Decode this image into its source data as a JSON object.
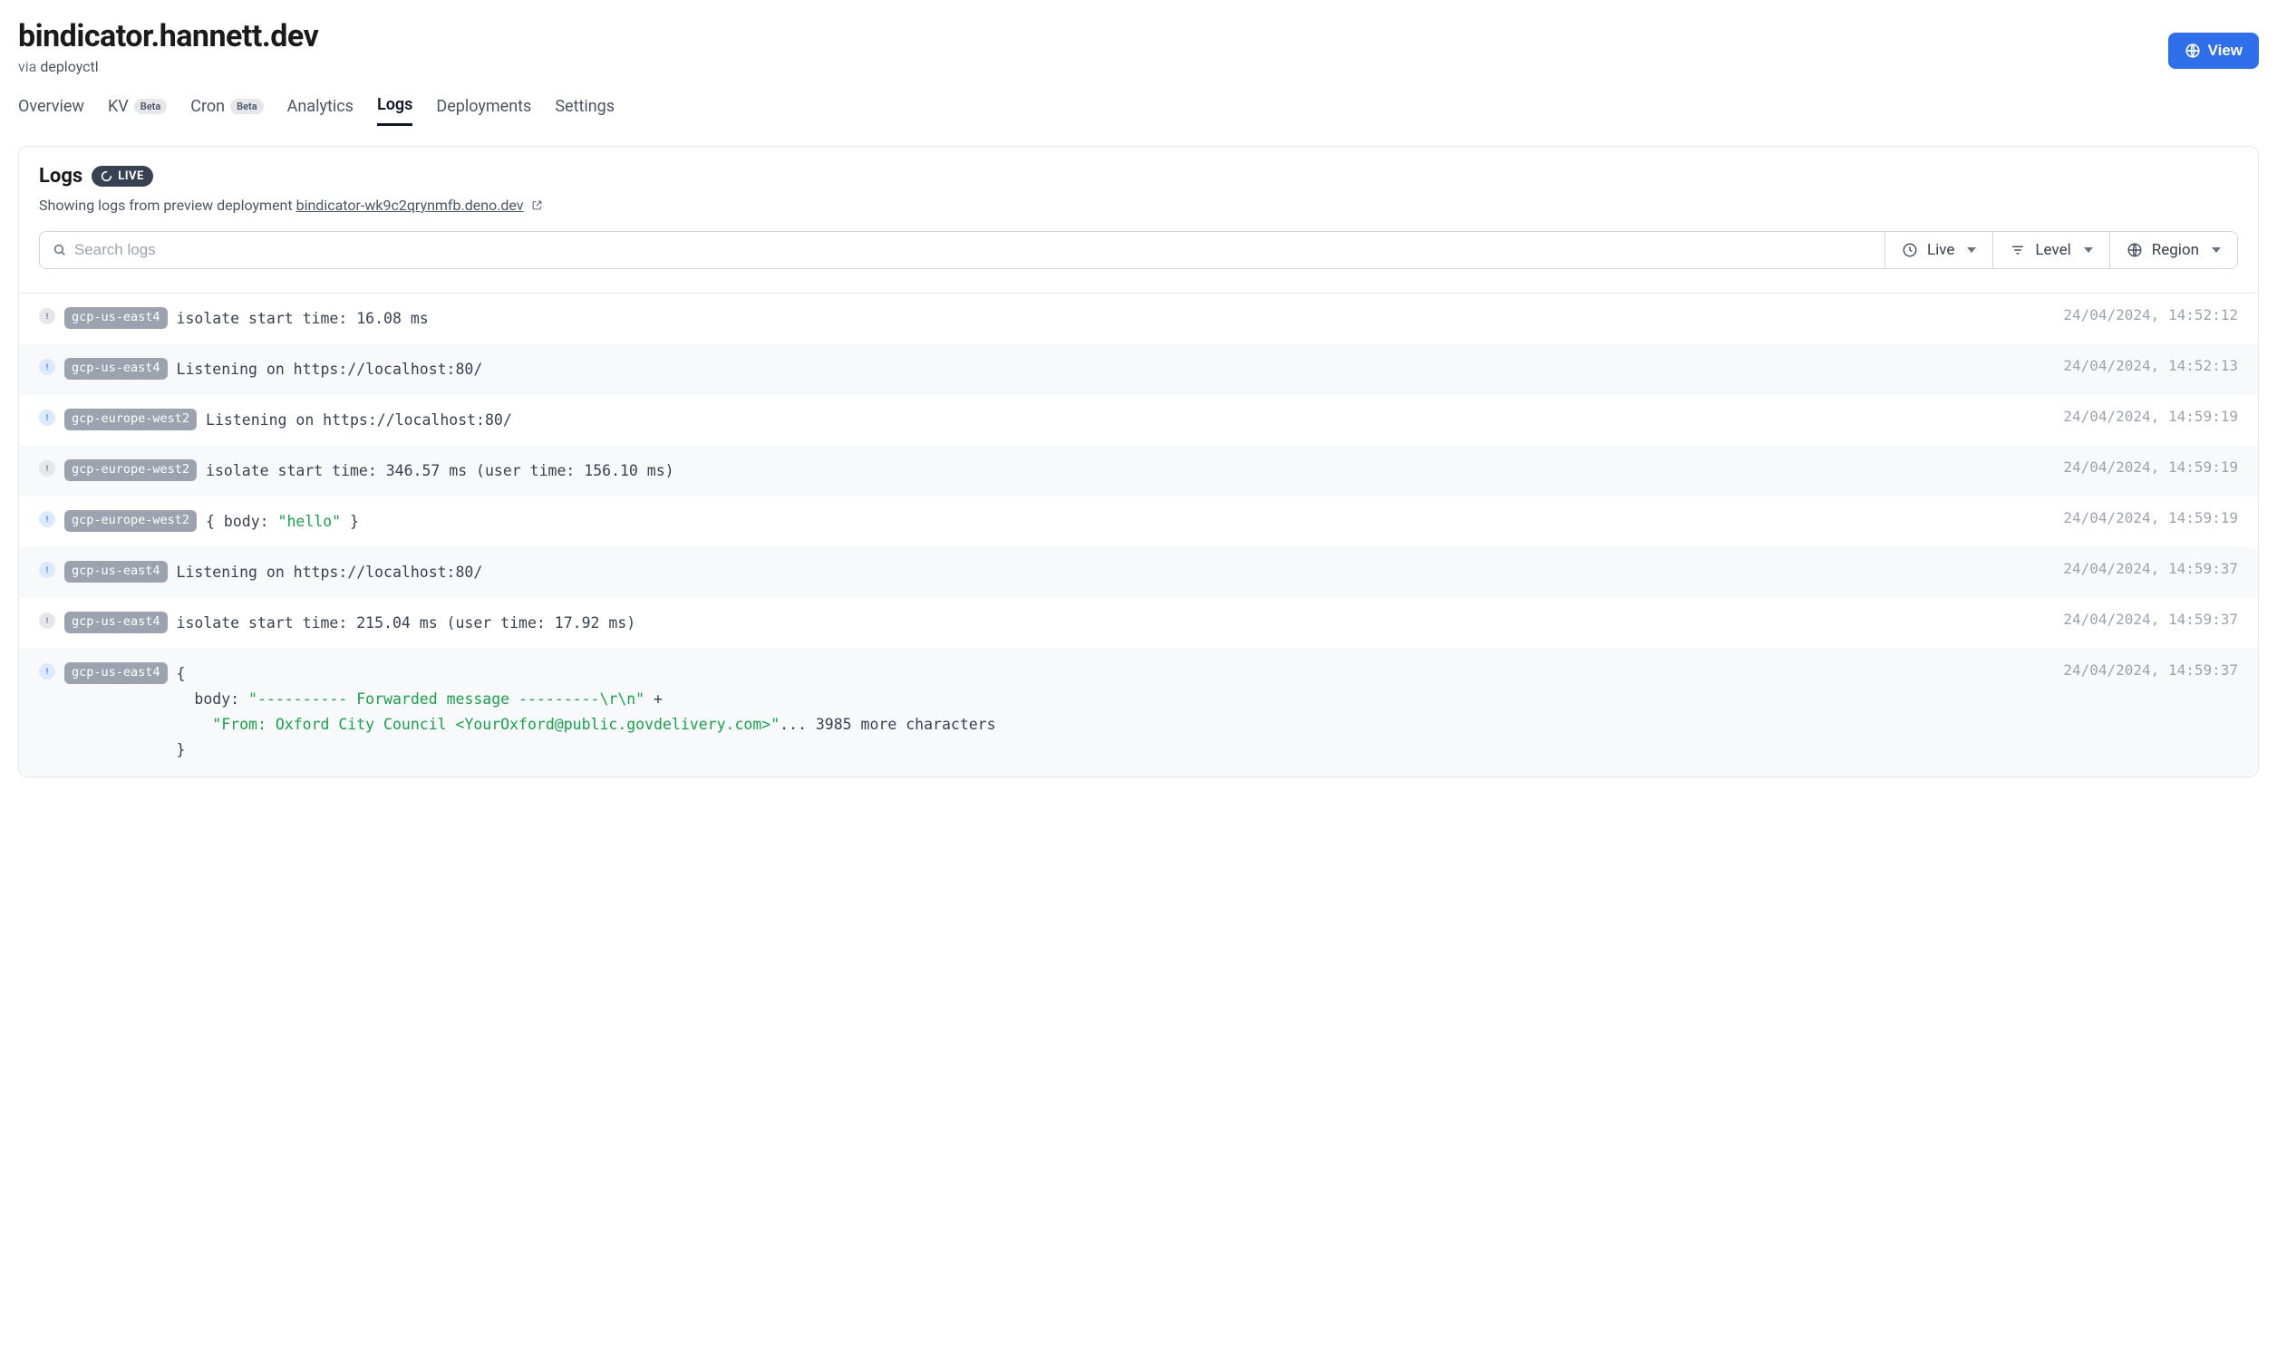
{
  "header": {
    "title": "bindicator.hannett.dev",
    "via_prefix": "via",
    "via_value": "deployctl",
    "view_button": "View"
  },
  "tabs": [
    {
      "label": "Overview",
      "active": false,
      "beta": false
    },
    {
      "label": "KV",
      "active": false,
      "beta": true
    },
    {
      "label": "Cron",
      "active": false,
      "beta": true
    },
    {
      "label": "Analytics",
      "active": false,
      "beta": false
    },
    {
      "label": "Logs",
      "active": true,
      "beta": false
    },
    {
      "label": "Deployments",
      "active": false,
      "beta": false
    },
    {
      "label": "Settings",
      "active": false,
      "beta": false
    }
  ],
  "beta_label": "Beta",
  "panel": {
    "title": "Logs",
    "live_label": "LIVE",
    "subtitle_prefix": "Showing logs from preview deployment ",
    "deployment_link": "bindicator-wk9c2qrynmfb.deno.dev"
  },
  "filters": {
    "search_placeholder": "Search logs",
    "live": "Live",
    "level": "Level",
    "region": "Region"
  },
  "logs": [
    {
      "level": "debug",
      "region": "gcp-us-east4",
      "msg_plain": "isolate start time: 16.08 ms",
      "ts": "24/04/2024, 14:52:12"
    },
    {
      "level": "info",
      "region": "gcp-us-east4",
      "msg_plain": "Listening on https://localhost:80/",
      "ts": "24/04/2024, 14:52:13"
    },
    {
      "level": "info",
      "region": "gcp-europe-west2",
      "msg_plain": "Listening on https://localhost:80/",
      "ts": "24/04/2024, 14:59:19"
    },
    {
      "level": "debug",
      "region": "gcp-europe-west2",
      "msg_plain": "isolate start time: 346.57 ms (user time: 156.10 ms)",
      "ts": "24/04/2024, 14:59:19"
    },
    {
      "level": "info",
      "region": "gcp-europe-west2",
      "msg_parts": [
        {
          "t": "{ body: "
        },
        {
          "t": "\"hello\"",
          "cls": "str"
        },
        {
          "t": " }"
        }
      ],
      "ts": "24/04/2024, 14:59:19"
    },
    {
      "level": "info",
      "region": "gcp-us-east4",
      "msg_plain": "Listening on https://localhost:80/",
      "ts": "24/04/2024, 14:59:37"
    },
    {
      "level": "debug",
      "region": "gcp-us-east4",
      "msg_plain": "isolate start time: 215.04 ms (user time: 17.92 ms)",
      "ts": "24/04/2024, 14:59:37"
    },
    {
      "level": "info",
      "region": "gcp-us-east4",
      "msg_parts": [
        {
          "t": "{\n"
        },
        {
          "t": "  body: "
        },
        {
          "t": "\"---------- Forwarded message ---------\\r\\n\"",
          "cls": "str"
        },
        {
          "t": " +\n"
        },
        {
          "t": "    "
        },
        {
          "t": "\"From: Oxford City Council <YourOxford@public.govdelivery.com>\"",
          "cls": "str"
        },
        {
          "t": "... 3985 more characters\n"
        },
        {
          "t": "}"
        }
      ],
      "ts": "24/04/2024, 14:59:37"
    }
  ]
}
